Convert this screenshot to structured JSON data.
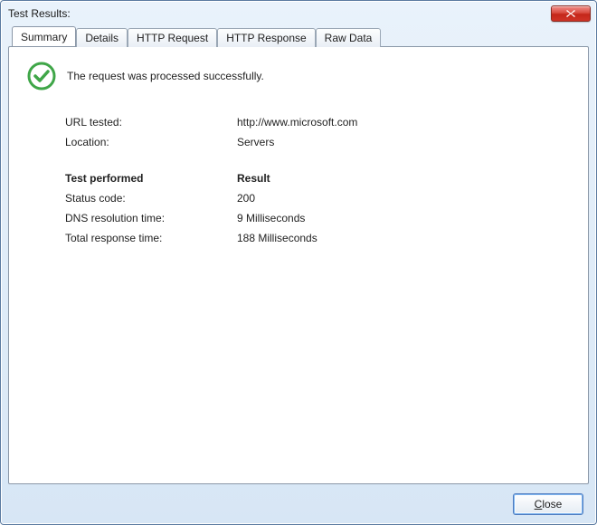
{
  "window": {
    "title": "Test Results:"
  },
  "tabs": {
    "summary": "Summary",
    "details": "Details",
    "http_request": "HTTP Request",
    "http_response": "HTTP Response",
    "raw_data": "Raw Data"
  },
  "status": {
    "icon": "checkmark-circle",
    "message": "The request was processed successfully."
  },
  "summary": {
    "url_tested_label": "URL tested:",
    "url_tested_value": "http://www.microsoft.com",
    "location_label": "Location:",
    "location_value": "Servers",
    "test_performed_heading": "Test performed",
    "result_heading": "Result",
    "status_code_label": "Status code:",
    "status_code_value": "200",
    "dns_time_label": "DNS resolution time:",
    "dns_time_value": "9 Milliseconds",
    "total_time_label": "Total response time:",
    "total_time_value": "188 Milliseconds"
  },
  "buttons": {
    "close_prefix": "C",
    "close_rest": "lose"
  }
}
